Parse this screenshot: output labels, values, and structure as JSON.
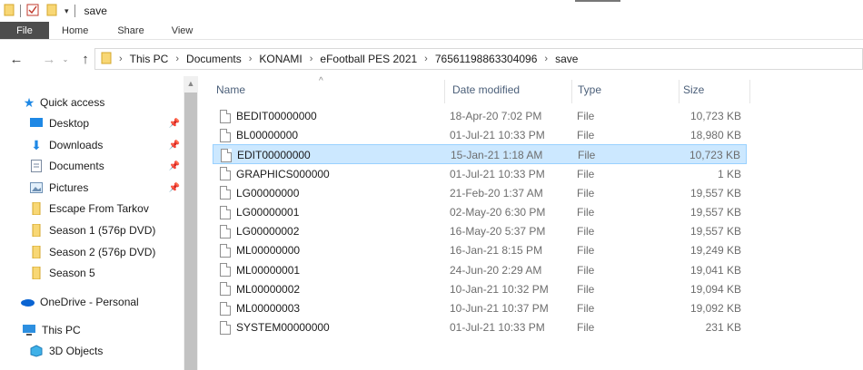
{
  "window": {
    "title": "save"
  },
  "ribbon": {
    "tabs": [
      "File",
      "Home",
      "Share",
      "View"
    ]
  },
  "breadcrumb": [
    "This PC",
    "Documents",
    "KONAMI",
    "eFootball PES 2021",
    "76561198863304096",
    "save"
  ],
  "sidebar": {
    "quick_access": "Quick access",
    "items": [
      {
        "label": "Desktop",
        "icon": "desktop-icon",
        "pinned": true
      },
      {
        "label": "Downloads",
        "icon": "downloads-icon",
        "pinned": true
      },
      {
        "label": "Documents",
        "icon": "documents-icon",
        "pinned": true
      },
      {
        "label": "Pictures",
        "icon": "pictures-icon",
        "pinned": true
      },
      {
        "label": "Escape From Tarkov",
        "icon": "folder-icon",
        "pinned": false
      },
      {
        "label": "Season 1 (576p DVD)",
        "icon": "folder-icon",
        "pinned": false
      },
      {
        "label": "Season 2 (576p DVD)",
        "icon": "folder-icon",
        "pinned": false
      },
      {
        "label": "Season 5",
        "icon": "folder-icon",
        "pinned": false
      }
    ],
    "onedrive": "OneDrive - Personal",
    "this_pc": "This PC",
    "objects3d": "3D Objects"
  },
  "columns": {
    "name": "Name",
    "date": "Date modified",
    "type": "Type",
    "size": "Size"
  },
  "files": [
    {
      "name": "BEDIT00000000",
      "date": "18-Apr-20 7:02 PM",
      "type": "File",
      "size": "10,723 KB",
      "selected": false
    },
    {
      "name": "BL00000000",
      "date": "01-Jul-21 10:33 PM",
      "type": "File",
      "size": "18,980 KB",
      "selected": false
    },
    {
      "name": "EDIT00000000",
      "date": "15-Jan-21 1:18 AM",
      "type": "File",
      "size": "10,723 KB",
      "selected": true
    },
    {
      "name": "GRAPHICS000000",
      "date": "01-Jul-21 10:33 PM",
      "type": "File",
      "size": "1 KB",
      "selected": false
    },
    {
      "name": "LG00000000",
      "date": "21-Feb-20 1:37 AM",
      "type": "File",
      "size": "19,557 KB",
      "selected": false
    },
    {
      "name": "LG00000001",
      "date": "02-May-20 6:30 PM",
      "type": "File",
      "size": "19,557 KB",
      "selected": false
    },
    {
      "name": "LG00000002",
      "date": "16-May-20 5:37 PM",
      "type": "File",
      "size": "19,557 KB",
      "selected": false
    },
    {
      "name": "ML00000000",
      "date": "16-Jan-21 8:15 PM",
      "type": "File",
      "size": "19,249 KB",
      "selected": false
    },
    {
      "name": "ML00000001",
      "date": "24-Jun-20 2:29 AM",
      "type": "File",
      "size": "19,041 KB",
      "selected": false
    },
    {
      "name": "ML00000002",
      "date": "10-Jan-21 10:32 PM",
      "type": "File",
      "size": "19,094 KB",
      "selected": false
    },
    {
      "name": "ML00000003",
      "date": "10-Jun-21 10:37 PM",
      "type": "File",
      "size": "19,092 KB",
      "selected": false
    },
    {
      "name": "SYSTEM00000000",
      "date": "01-Jul-21 10:33 PM",
      "type": "File",
      "size": "231 KB",
      "selected": false
    }
  ],
  "colors": {
    "selection": "#cce8ff",
    "selection_border": "#99d1ff",
    "header_text": "#4c607a",
    "file_tab": "#4d4d4d"
  }
}
